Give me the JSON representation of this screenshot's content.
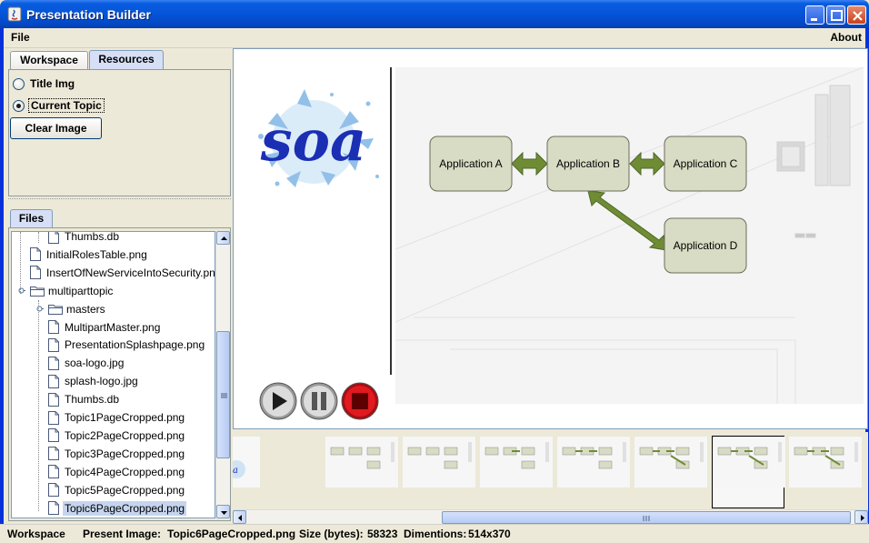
{
  "window": {
    "title": "Presentation Builder"
  },
  "menu": {
    "file": "File",
    "about": "About"
  },
  "top_tabs": {
    "workspace": "Workspace",
    "resources": "Resources",
    "active": "Resources"
  },
  "resources": {
    "radio_title_img": "Title Img",
    "radio_current_topic": "Current Topic",
    "selected": "Current Topic",
    "clear_button": "Clear Image"
  },
  "files_tab": "Files",
  "file_tree": [
    {
      "label": "Thumbs.db",
      "type": "file",
      "level": 2
    },
    {
      "label": "InitialRolesTable.png",
      "type": "file",
      "level": 1
    },
    {
      "label": "InsertOfNewServiceIntoSecurity.pn",
      "type": "file",
      "level": 1
    },
    {
      "label": "multiparttopic",
      "type": "folder",
      "level": 1
    },
    {
      "label": "masters",
      "type": "folder",
      "level": 2
    },
    {
      "label": "MultipartMaster.png",
      "type": "file",
      "level": 2
    },
    {
      "label": "PresentationSplashpage.png",
      "type": "file",
      "level": 2
    },
    {
      "label": "soa-logo.jpg",
      "type": "file",
      "level": 2
    },
    {
      "label": "splash-logo.jpg",
      "type": "file",
      "level": 2
    },
    {
      "label": "Thumbs.db",
      "type": "file",
      "level": 2
    },
    {
      "label": "Topic1PageCropped.png",
      "type": "file",
      "level": 2
    },
    {
      "label": "Topic2PageCropped.png",
      "type": "file",
      "level": 2
    },
    {
      "label": "Topic3PageCropped.png",
      "type": "file",
      "level": 2
    },
    {
      "label": "Topic4PageCropped.png",
      "type": "file",
      "level": 2
    },
    {
      "label": "Topic5PageCropped.png",
      "type": "file",
      "level": 2
    },
    {
      "label": "Topic6PageCropped.png",
      "type": "file",
      "level": 2,
      "selected": true
    }
  ],
  "slide": {
    "logo_text": "soa",
    "boxes": {
      "a": "Application A",
      "b": "Application B",
      "c": "Application C",
      "d": "Application D"
    }
  },
  "controls": {
    "play": "play-icon",
    "pause": "pause-icon",
    "stop": "stop-icon"
  },
  "status": {
    "mode": "Workspace",
    "present_image_label": "Present Image:",
    "present_image_value": "Topic6PageCropped.png",
    "size_label": "Size (bytes):",
    "size_value": "58323",
    "dimensions_label": "Dimentions:",
    "dimensions_value": "514x370"
  },
  "colors": {
    "title_bar": "#0553d8",
    "box_fill": "#d8dcc4",
    "arrow": "#6f8c35",
    "stop_red": "#d8141b",
    "selection": "#c5d5ef"
  }
}
